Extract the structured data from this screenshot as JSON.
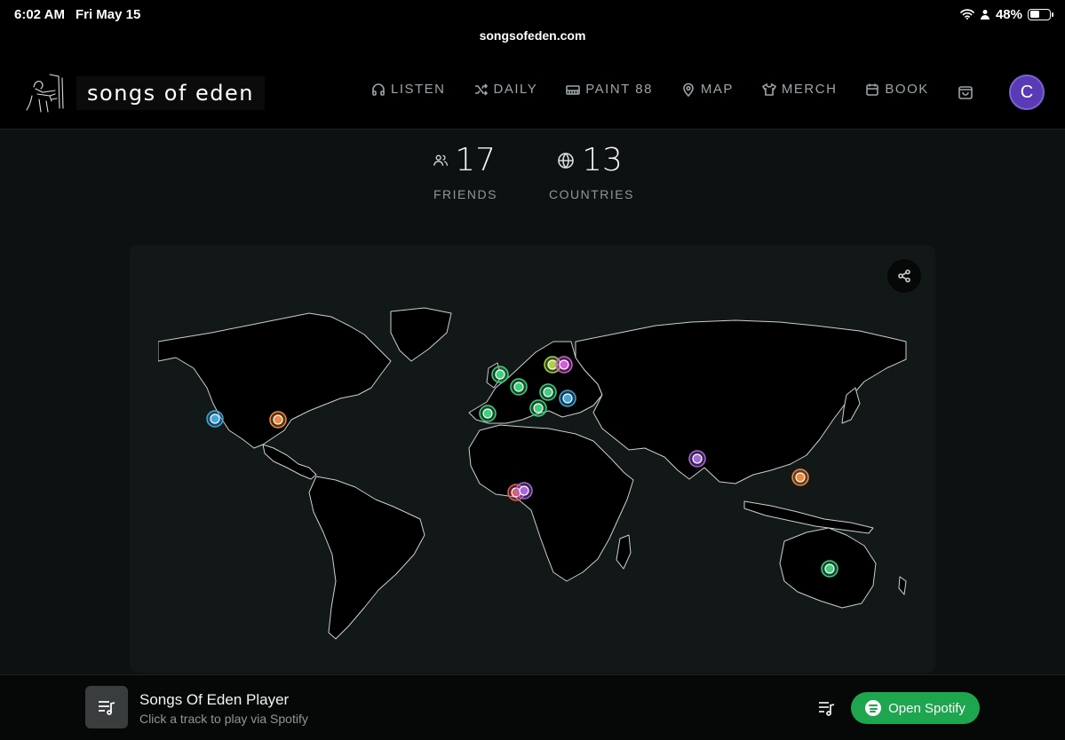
{
  "status_bar": {
    "time": "6:02 AM",
    "date": "Fri May 15",
    "battery": "48%",
    "battery_level": 0.48
  },
  "browser": {
    "url": "songsofeden.com"
  },
  "header": {
    "brand": "songs of eden",
    "nav": [
      {
        "label": "LISTEN",
        "icon": "headphones-icon"
      },
      {
        "label": "DAILY",
        "icon": "shuffle-icon"
      },
      {
        "label": "PAINT 88",
        "icon": "piano-icon"
      },
      {
        "label": "MAP",
        "icon": "map-pin-icon"
      },
      {
        "label": "MERCH",
        "icon": "shirt-icon"
      },
      {
        "label": "BOOK",
        "icon": "calendar-icon"
      }
    ],
    "avatar_initial": "C"
  },
  "stats": {
    "friends": {
      "value": "17",
      "label": "FRIENDS"
    },
    "countries": {
      "value": "13",
      "label": "COUNTRIES"
    }
  },
  "map": {
    "markers": [
      {
        "place": "california",
        "color": "#3ea6e0"
      },
      {
        "place": "texas",
        "color": "#f08a3a"
      },
      {
        "place": "portugal",
        "color": "#3ed07a"
      },
      {
        "place": "ireland",
        "color": "#3ed07a"
      },
      {
        "place": "netherlands",
        "color": "#3ed07a"
      },
      {
        "place": "sweden",
        "color": "#a7d63c"
      },
      {
        "place": "finland",
        "color": "#d65adf"
      },
      {
        "place": "germany",
        "color": "#3ed07a"
      },
      {
        "place": "italy",
        "color": "#3ed07a"
      },
      {
        "place": "hungary",
        "color": "#3ea6e0"
      },
      {
        "place": "nigeria-west",
        "color": "#e85a5a"
      },
      {
        "place": "nigeria-east",
        "color": "#a866e0"
      },
      {
        "place": "india",
        "color": "#a866e0"
      },
      {
        "place": "philippines",
        "color": "#f08a3a"
      },
      {
        "place": "australia",
        "color": "#3ed07a"
      }
    ]
  },
  "player": {
    "title": "Songs Of Eden Player",
    "subtitle": "Click a track to play via Spotify",
    "spotify_label": "Open Spotify",
    "accent": "#1ea64e"
  }
}
